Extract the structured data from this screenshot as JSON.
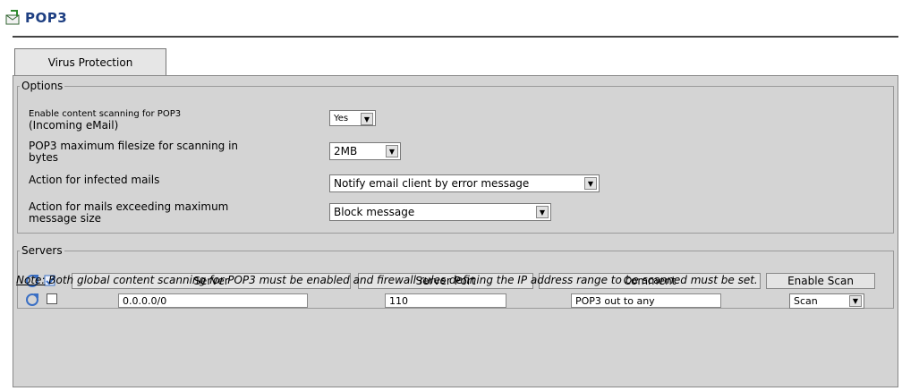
{
  "header": {
    "title": "POP3",
    "icon": "pop3-mail-icon"
  },
  "tabs": [
    {
      "label": "Virus Protection",
      "active": true
    }
  ],
  "options": {
    "legend": "Options",
    "rows": [
      {
        "label_line1": "Enable content scanning for POP3",
        "label_line2": "(Incoming eMail)",
        "value": "Yes"
      },
      {
        "label_line1": "POP3 maximum filesize for scanning in",
        "label_line2": "bytes",
        "value": "2MB"
      },
      {
        "label_line1": "Action for infected mails",
        "label_line2": "",
        "value": "Notify email client by error message"
      },
      {
        "label_line1": "Action for mails exceeding maximum",
        "label_line2": "message size",
        "value": "Block message"
      }
    ]
  },
  "servers": {
    "legend": "Servers",
    "columns": [
      "Server",
      "Server Port",
      "Comment",
      "Enable Scan"
    ],
    "rows": [
      {
        "server": "0.0.0.0/0",
        "port": "110",
        "comment": "POP3 out to any",
        "scan": "Scan"
      }
    ]
  },
  "note": {
    "label": "Note:",
    "text": "Both global content scanning for POP3 must be enabled and firewall rules defining the IP address range to be scanned must be set."
  }
}
